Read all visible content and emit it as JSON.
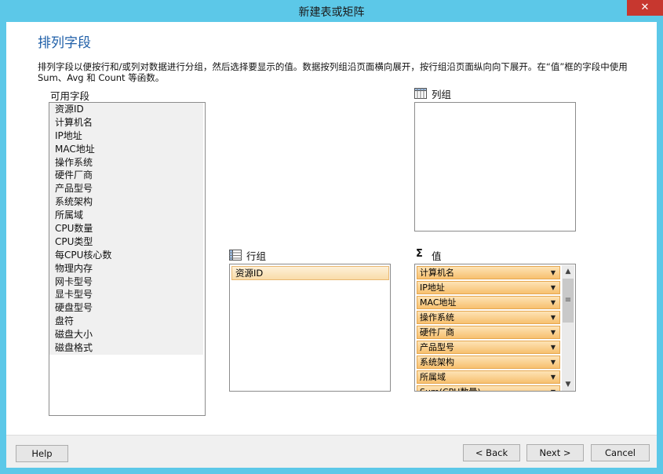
{
  "window": {
    "title": "新建表或矩阵",
    "close_glyph": "✕"
  },
  "page": {
    "title": "排列字段",
    "description": "排列字段以便按行和/或列对数据进行分组，然后选择要显示的值。数据按列组沿页面横向展开，按行组沿页面纵向向下展开。在“值”框的字段中使用 Sum、Avg 和 Count 等函数。"
  },
  "available_fields": {
    "label": "可用字段",
    "items": [
      "资源ID",
      "计算机名",
      "IP地址",
      "MAC地址",
      "操作系统",
      "硬件厂商",
      "产品型号",
      "系统架构",
      "所属域",
      "CPU数量",
      "CPU类型",
      "每CPU核心数",
      "物理内存",
      "网卡型号",
      "显卡型号",
      "硬盘型号",
      "盘符",
      "磁盘大小",
      "磁盘格式"
    ]
  },
  "column_groups": {
    "label": "列组",
    "items": []
  },
  "row_groups": {
    "label": "行组",
    "items": [
      "资源ID"
    ]
  },
  "values": {
    "label": "值",
    "sigma": "Σ",
    "items": [
      "计算机名",
      "IP地址",
      "MAC地址",
      "操作系统",
      "硬件厂商",
      "产品型号",
      "系统架构",
      "所属域",
      "Sum(CPU数量)"
    ],
    "dropdown_glyph": "▼",
    "scroll_up": "▲",
    "scroll_down": "▼",
    "scroll_grip": "≡"
  },
  "buttons": {
    "help": "Help",
    "back": "< Back",
    "next": "Next >",
    "cancel": "Cancel"
  }
}
